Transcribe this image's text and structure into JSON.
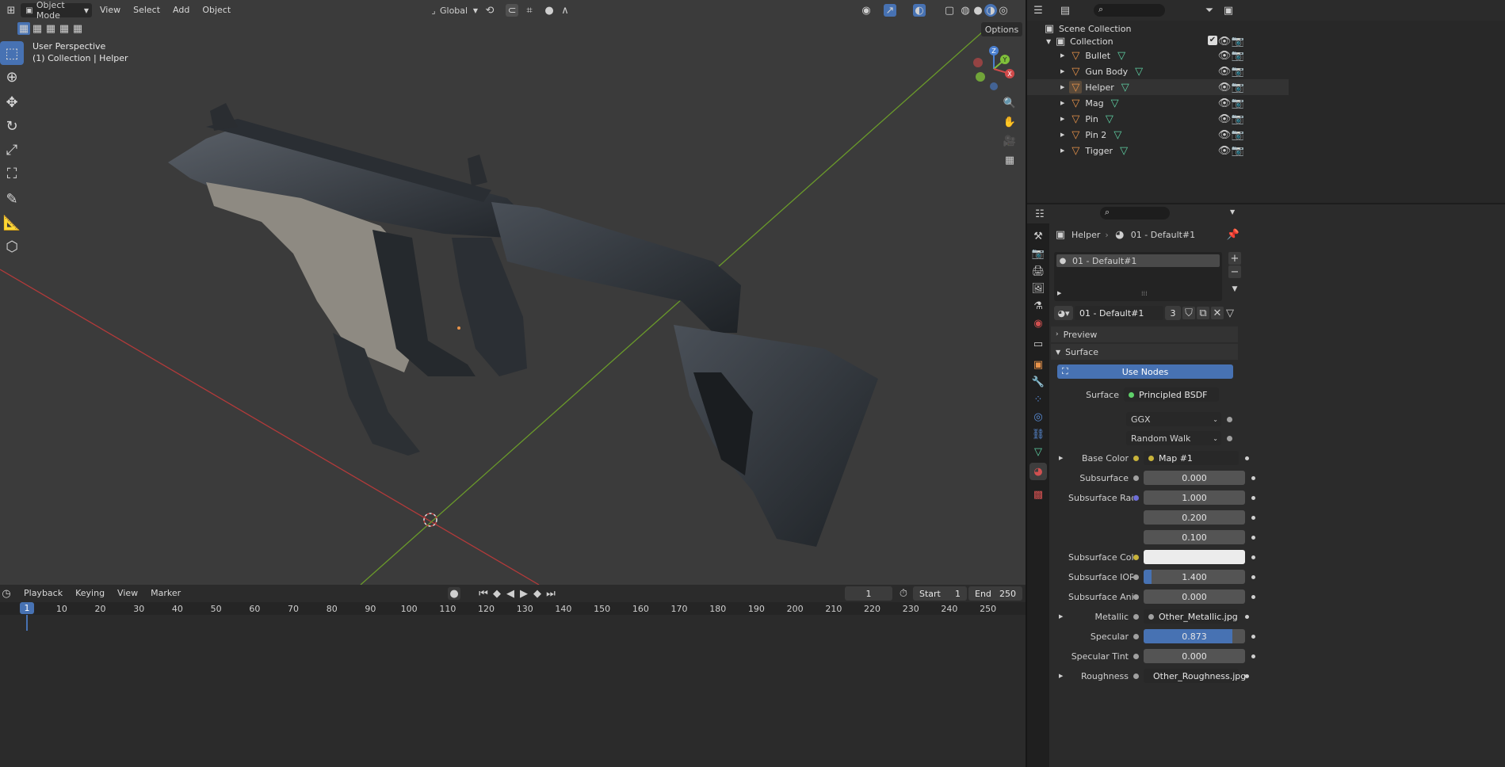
{
  "viewport_header": {
    "mode": "Object Mode",
    "menus": [
      "View",
      "Select",
      "Add",
      "Object"
    ],
    "transform_orientation": "Global",
    "options": "Options"
  },
  "viewport": {
    "perspective": "User Perspective",
    "collection_info": "(1) Collection | Helper",
    "axis_labels": {
      "z": "Z",
      "y": "Y",
      "x": "X"
    }
  },
  "tools": [
    "select-box-icon",
    "cursor-icon",
    "move-icon",
    "rotate-icon",
    "scale-icon",
    "transform-icon",
    "annotate-icon",
    "measure-icon",
    "add-cube-icon"
  ],
  "outliner": {
    "scene_collection": "Scene Collection",
    "collection": "Collection",
    "objects": [
      "Bullet",
      "Gun Body",
      "Helper",
      "Mag",
      "Pin",
      "Pin 2",
      "Tigger"
    ],
    "selected": "Helper"
  },
  "properties": {
    "breadcrumb_object": "Helper",
    "breadcrumb_material": "01 - Default#1",
    "slot_name": "01 - Default#1",
    "material_name": "01 - Default#1",
    "users": "3",
    "panels": {
      "preview": "Preview",
      "surface": "Surface"
    },
    "use_nodes": "Use Nodes",
    "surface_label": "Surface",
    "surface_shader": "Principled BSDF",
    "distribution": "GGX",
    "subsurface_method": "Random Walk",
    "rows": [
      {
        "label": "Base Color",
        "value": "Map #1",
        "kind": "link",
        "dot": "#c8b33a",
        "expand": true
      },
      {
        "label": "Subsurface",
        "value": "0.000",
        "kind": "num",
        "dot": "#a0a0a0"
      },
      {
        "label": "Subsurface Radius",
        "value": "1.000",
        "kind": "num",
        "dot": "#6e6ed6"
      },
      {
        "label": "",
        "value": "0.200",
        "kind": "num",
        "dot": ""
      },
      {
        "label": "",
        "value": "0.100",
        "kind": "num",
        "dot": ""
      },
      {
        "label": "Subsurface Color",
        "value": "",
        "kind": "color",
        "dot": "#c8b33a"
      },
      {
        "label": "Subsurface IOR",
        "value": "1.400",
        "kind": "num",
        "dot": "#a0a0a0",
        "fill": 0.08
      },
      {
        "label": "Subsurface Anisot...",
        "value": "0.000",
        "kind": "num",
        "dot": "#a0a0a0"
      },
      {
        "label": "Metallic",
        "value": "Other_Metallic.jpg",
        "kind": "link",
        "dot": "#a0a0a0",
        "expand": true
      },
      {
        "label": "Specular",
        "value": "0.873",
        "kind": "num",
        "dot": "#a0a0a0",
        "fill": 0.873
      },
      {
        "label": "Specular Tint",
        "value": "0.000",
        "kind": "num",
        "dot": "#a0a0a0"
      },
      {
        "label": "Roughness",
        "value": "Other_Roughness.jpg",
        "kind": "link",
        "dot": "#a0a0a0",
        "expand": true
      }
    ]
  },
  "timeline": {
    "menus": [
      "Playback",
      "Keying",
      "View",
      "Marker"
    ],
    "current_frame": "1",
    "start_label": "Start",
    "start": "1",
    "end_label": "End",
    "end": "250",
    "ticks": [
      "1",
      "10",
      "20",
      "30",
      "40",
      "50",
      "60",
      "70",
      "80",
      "90",
      "100",
      "110",
      "120",
      "130",
      "140",
      "150",
      "160",
      "170",
      "180",
      "190",
      "200",
      "210",
      "220",
      "230",
      "240",
      "250"
    ]
  },
  "colors": {
    "accent": "#4772b3",
    "x_axis": "#b33a3a",
    "y_axis": "#6a9a2a",
    "object_orange": "#e8934a",
    "mesh_green": "#5fd1a4"
  }
}
